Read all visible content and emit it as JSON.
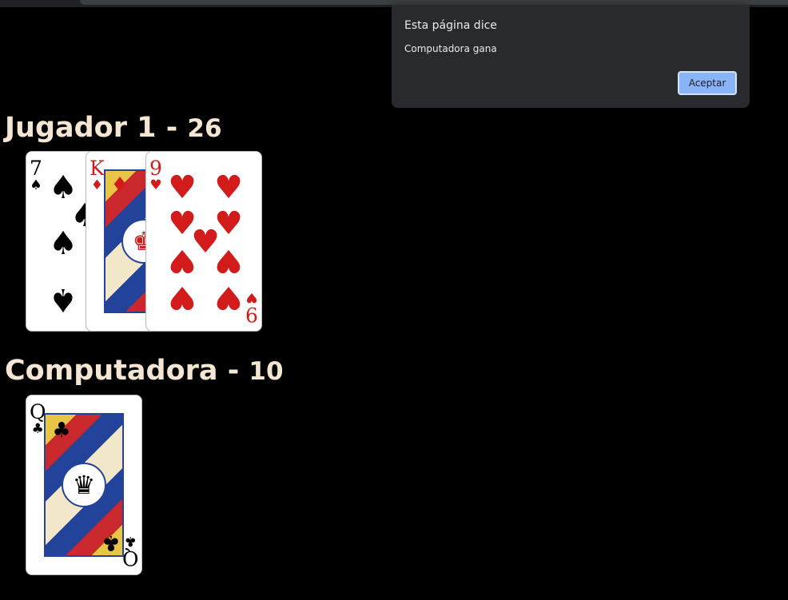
{
  "dialog": {
    "title": "Esta página dice",
    "message": "Computadora gana",
    "accept_label": "Aceptar"
  },
  "player": {
    "name": "Jugador 1",
    "separator": "-",
    "score": "26",
    "cards": [
      {
        "rank": "7",
        "suit": "♠",
        "suit_name": "spades",
        "color": "#000000"
      },
      {
        "rank": "K",
        "suit": "♦",
        "suit_name": "diamonds",
        "color": "#d21c1c"
      },
      {
        "rank": "9",
        "suit": "♥",
        "suit_name": "hearts",
        "color": "#d21c1c"
      }
    ]
  },
  "computer": {
    "name": "Computadora",
    "separator": "-",
    "score": "10",
    "cards": [
      {
        "rank": "Q",
        "suit": "♣",
        "suit_name": "clubs",
        "color": "#000000"
      }
    ]
  }
}
